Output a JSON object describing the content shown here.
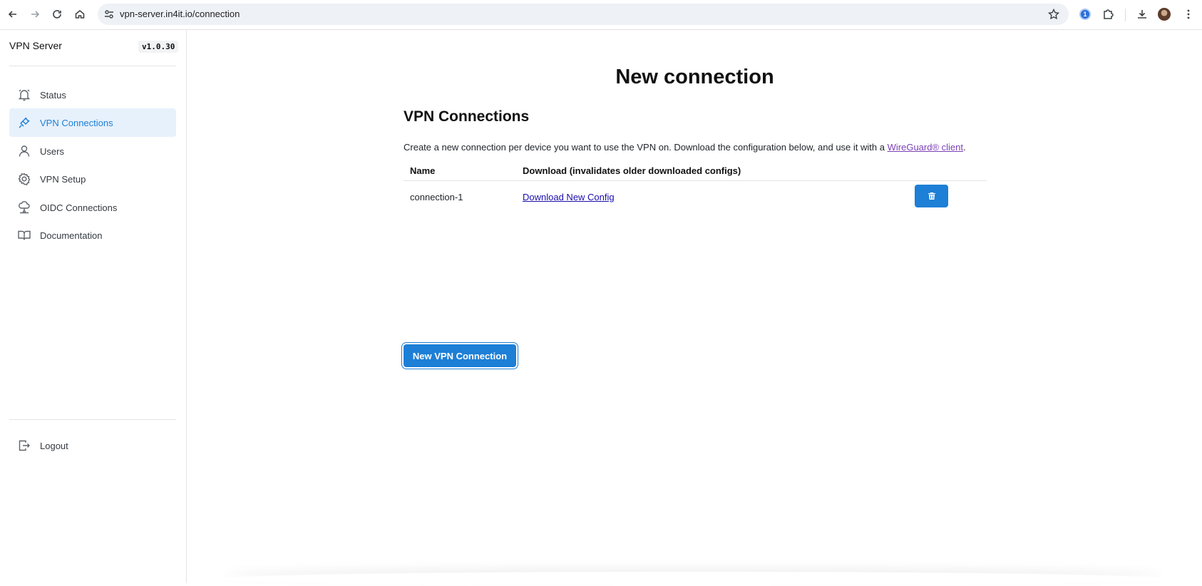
{
  "browser": {
    "url": "vpn-server.in4it.io/connection",
    "extension_badge": "1"
  },
  "sidebar": {
    "brand": "VPN Server",
    "version": "v1.0.30",
    "items": [
      {
        "label": "Status",
        "icon": "bell-icon"
      },
      {
        "label": "VPN Connections",
        "icon": "plug-icon",
        "active": true
      },
      {
        "label": "Users",
        "icon": "user-icon"
      },
      {
        "label": "VPN Setup",
        "icon": "gear-icon"
      },
      {
        "label": "OIDC Connections",
        "icon": "cloud-network-icon"
      },
      {
        "label": "Documentation",
        "icon": "book-icon"
      }
    ],
    "logout_label": "Logout"
  },
  "main": {
    "page_title": "New connection",
    "section_title": "VPN Connections",
    "intro_text": "Create a new connection per device you want to use the VPN on. Download the configuration below, and use it with a",
    "intro_link": "WireGuard® client",
    "intro_end": ".",
    "table": {
      "headers": [
        "Name",
        "Download (invalidates older downloaded configs)"
      ],
      "rows": [
        {
          "name": "connection-1",
          "download_label": "Download New Config"
        }
      ]
    },
    "new_button_label": "New VPN Connection"
  },
  "colors": {
    "accent": "#1d7fd6",
    "active_bg": "#e7f1fc",
    "link_visited": "#7b3fb5",
    "link": "#1a0dab"
  }
}
